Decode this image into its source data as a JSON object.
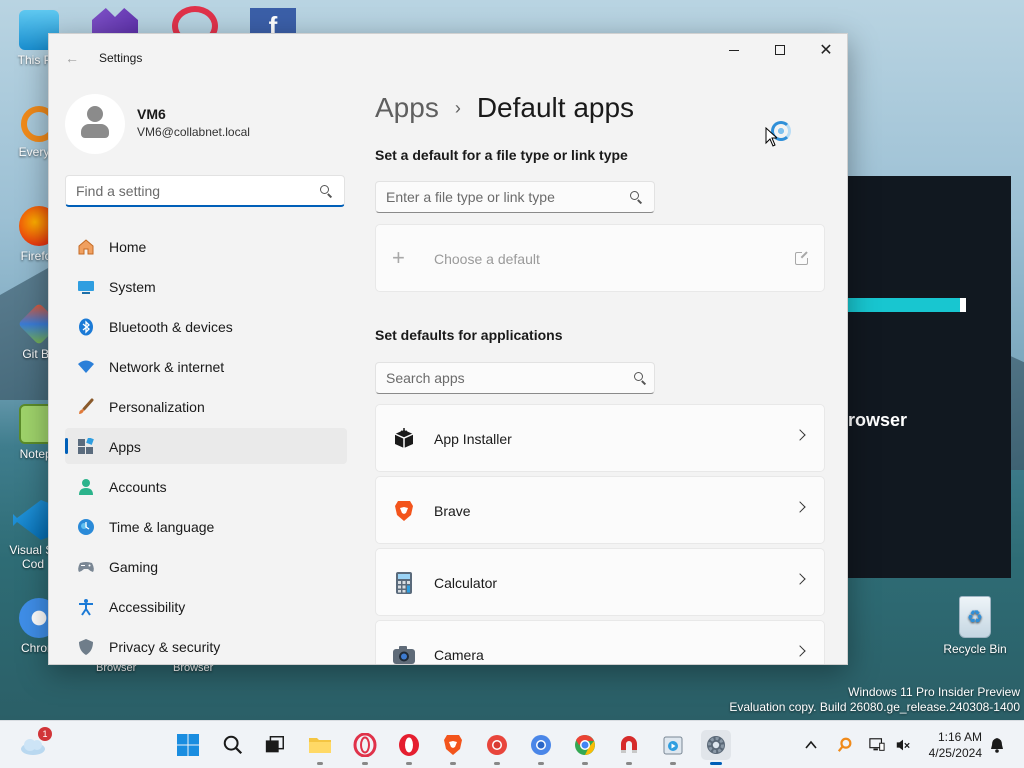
{
  "window": {
    "title": "Settings",
    "minimize": "—",
    "maximize": "☐",
    "close": "✕"
  },
  "profile": {
    "name": "VM6",
    "email": "VM6@collabnet.local"
  },
  "sidebar": {
    "search_placeholder": "Find a setting",
    "items": [
      {
        "label": "Home",
        "icon": "home-icon"
      },
      {
        "label": "System",
        "icon": "monitor-icon"
      },
      {
        "label": "Bluetooth & devices",
        "icon": "bluetooth-icon"
      },
      {
        "label": "Network & internet",
        "icon": "wifi-icon"
      },
      {
        "label": "Personalization",
        "icon": "brush-icon"
      },
      {
        "label": "Apps",
        "icon": "apps-icon",
        "active": true
      },
      {
        "label": "Accounts",
        "icon": "person-icon"
      },
      {
        "label": "Time & language",
        "icon": "globe-clock-icon"
      },
      {
        "label": "Gaming",
        "icon": "gamepad-icon"
      },
      {
        "label": "Accessibility",
        "icon": "accessibility-icon"
      },
      {
        "label": "Privacy & security",
        "icon": "shield-icon"
      }
    ]
  },
  "main": {
    "breadcrumb_parent": "Apps",
    "breadcrumb_separator": "›",
    "page_title": "Default apps",
    "file_type_section": {
      "title": "Set a default for a file type or link type",
      "placeholder": "Enter a file type or link type",
      "choose_label": "Choose a default"
    },
    "apps_section": {
      "title": "Set defaults for applications",
      "placeholder": "Search apps",
      "apps": [
        {
          "label": "App Installer",
          "icon": "box-icon"
        },
        {
          "label": "Brave",
          "icon": "brave-lion-icon"
        },
        {
          "label": "Calculator",
          "icon": "calculator-icon"
        },
        {
          "label": "Camera",
          "icon": "camera-icon"
        }
      ]
    }
  },
  "desktop": {
    "icons": [
      {
        "label": "This PC"
      },
      {
        "label": "Everyth"
      },
      {
        "label": "Firefox"
      },
      {
        "label": "Git Ba"
      },
      {
        "label": "Notepa"
      },
      {
        "label": "Visual St Cod"
      },
      {
        "label": "Chrom"
      }
    ],
    "browser_label_1": "Browser",
    "browser_label_2": "Browser",
    "recycle_bin": "Recycle Bin",
    "background_window_text": "rowser",
    "watermark_line1": "Windows 11 Pro Insider Preview",
    "watermark_line2": "Evaluation copy. Build 26080.ge_release.240308-1400"
  },
  "taskbar": {
    "weather_badge": "1",
    "time": "1:16 AM",
    "date": "4/25/2024",
    "apps": [
      "start-icon",
      "search-icon",
      "task-view-icon",
      "file-explorer-icon",
      "opera-gx-icon",
      "opera-icon",
      "brave-icon",
      "chromium-icon",
      "chrome-beta-icon",
      "chrome-icon",
      "magnet-icon",
      "media-player-icon",
      "settings-icon"
    ]
  }
}
